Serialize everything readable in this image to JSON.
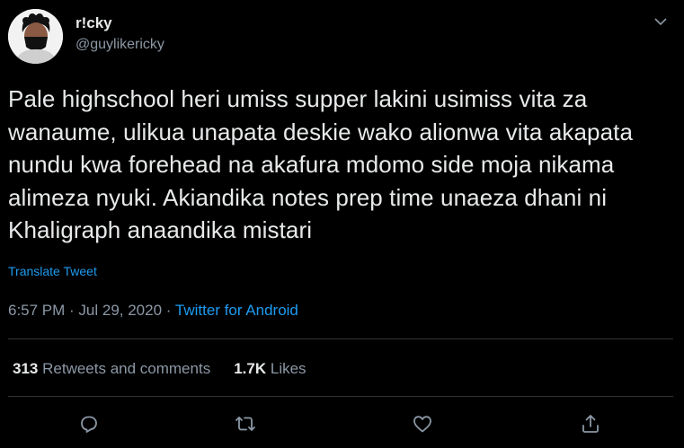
{
  "author": {
    "display_name": "r!cky",
    "handle": "@guylikericky"
  },
  "tweet": {
    "text": "Pale highschool heri umiss supper lakini usimiss vita za wanaume, ulikua unapata deskie wako alionwa vita akapata nundu kwa forehead na akafura mdomo side moja nikama alimeza nyuki. Akiandika notes prep time unaeza dhani ni Khaligraph anaandika mistari",
    "translate_label": "Translate Tweet",
    "time": "6:57 PM",
    "separator1": " · ",
    "date": "Jul 29, 2020",
    "separator2": " · ",
    "source": "Twitter for Android"
  },
  "stats": {
    "retweets_count": "313",
    "retweets_label": "Retweets and comments",
    "likes_count": "1.7K",
    "likes_label": "Likes"
  },
  "icons": {
    "menu": "chevron-down-icon",
    "reply": "reply-icon",
    "retweet": "retweet-icon",
    "like": "heart-icon",
    "share": "share-icon"
  },
  "colors": {
    "background": "#000000",
    "accent": "#1d9bf0",
    "secondary_text": "#8b98a5"
  }
}
